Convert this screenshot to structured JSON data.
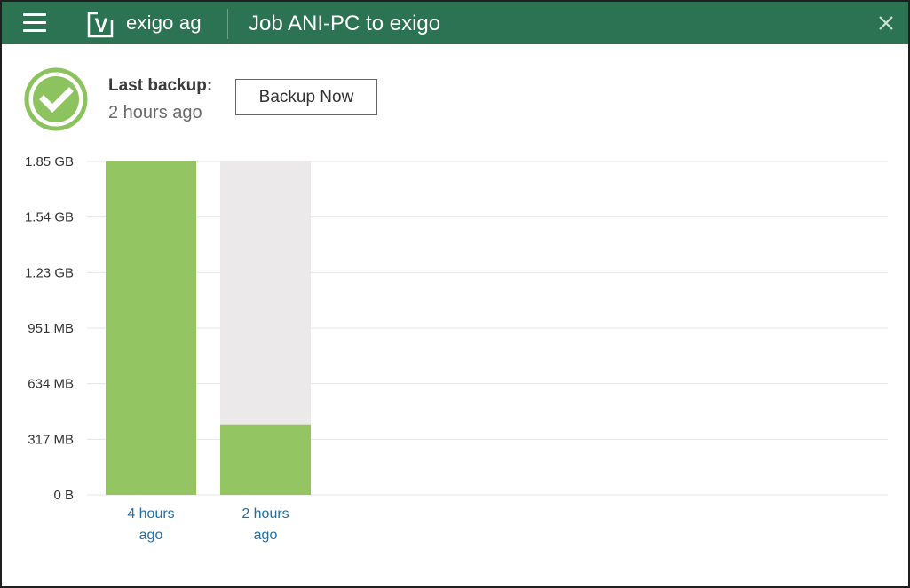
{
  "header": {
    "brand": "exigo ag",
    "job_title": "Job ANI-PC to exigo",
    "logo_letter": "V",
    "menu_icon": "hamburger-menu-icon",
    "close_icon": "close-icon",
    "bar_color": "#2b7352"
  },
  "status": {
    "icon": "success-check-icon",
    "label": "Last backup:",
    "value": "2 hours ago",
    "color": "#8dc35f"
  },
  "actions": {
    "backup_now": "Backup Now"
  },
  "chart_data": {
    "type": "bar",
    "yticks": [
      "0 B",
      "317 MB",
      "634 MB",
      "951 MB",
      "1.23 GB",
      "1.54 GB",
      "1.85 GB"
    ],
    "ylim": [
      0,
      1.85
    ],
    "unit": "GB",
    "categories": [
      [
        "4 hours",
        "ago"
      ],
      [
        "2 hours",
        "ago"
      ]
    ],
    "values": [
      1.85,
      0.39
    ],
    "background_max": [
      0,
      1.85
    ],
    "bar_color": "#93c663",
    "background_color": "#ebe9ea",
    "grid": true
  }
}
